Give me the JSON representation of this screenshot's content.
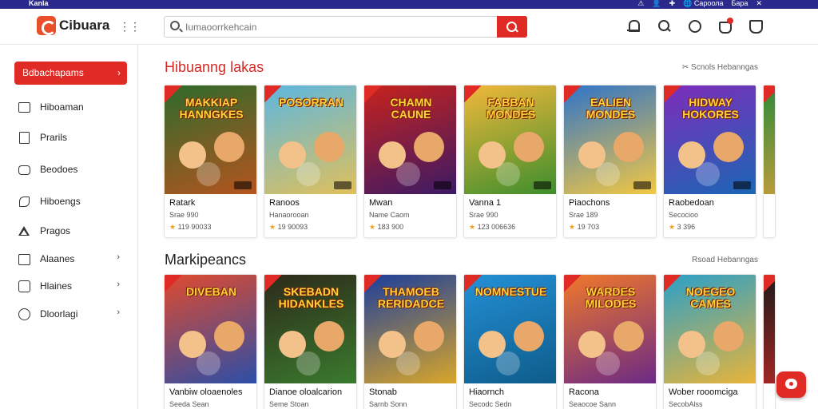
{
  "sysbar": {
    "brand": "Kanla",
    "items": [
      "⚠",
      "👤",
      "✚",
      "🌐 Сароола",
      "Бара",
      "✕"
    ]
  },
  "header": {
    "logo_text": "Cibuara",
    "search": {
      "placeholder": "Iumaoorrkehcain",
      "value": ""
    }
  },
  "sidebar": {
    "active": "Bdbachapams",
    "items": [
      {
        "label": "Hiboaman",
        "icon": "image-icon",
        "chevron": false
      },
      {
        "label": "Prarils",
        "icon": "document-icon",
        "chevron": false
      },
      {
        "label": "Beodoes",
        "icon": "pill-icon",
        "chevron": false
      },
      {
        "label": "Hiboengs",
        "icon": "phone-icon",
        "chevron": false
      },
      {
        "label": "Pragos",
        "icon": "triangle-icon",
        "chevron": false
      },
      {
        "label": "Alaanes",
        "icon": "square-icon",
        "chevron": true
      },
      {
        "label": "Hlaines",
        "icon": "badge-icon",
        "chevron": true
      },
      {
        "label": "Dloorlagi",
        "icon": "circle-icon",
        "chevron": true
      }
    ]
  },
  "sections": [
    {
      "title": "Hibuanng lakas",
      "link": "✂ Scnols  Hebanngas",
      "cards": [
        {
          "art_title": "MAKKIAP\nHANNGKES",
          "title": "Ratark",
          "sub": "Srae 990",
          "rating": "119 90033",
          "c1": "#2e6b2b",
          "c2": "#b5541f"
        },
        {
          "art_title": "POSORRAN",
          "title": "Ranoos",
          "sub": "Hanaorooan",
          "rating": "19 90093",
          "c1": "#5cb7e0",
          "c2": "#e1c05b"
        },
        {
          "art_title": "CHAMN\nCAUNE",
          "title": "Mwan",
          "sub": "Name Caom",
          "rating": "183 900",
          "c1": "#c8221c",
          "c2": "#3a1a66"
        },
        {
          "art_title": "FABBAN\nMONDES",
          "title": "Vanna 1",
          "sub": "Srae 990",
          "rating": "123 006636",
          "c1": "#f2b83a",
          "c2": "#3c8e2d"
        },
        {
          "art_title": "EALIEN\nMONDES",
          "title": "Piaochons",
          "sub": "Srae 189",
          "rating": "19 703",
          "c1": "#2f74c9",
          "c2": "#f4c842"
        },
        {
          "art_title": "HIDWAY\nHOKORES",
          "title": "Raobedoan",
          "sub": "Secocioo",
          "rating": "3 396",
          "c1": "#7e2dba",
          "c2": "#1b66b5"
        },
        {
          "art_title": "",
          "title": "",
          "sub": "",
          "rating": "",
          "c1": "#2b8a3a",
          "c2": "#e0a13a"
        }
      ]
    },
    {
      "title": "Markipeancs",
      "link": "Rsoad  Hebanngas",
      "cards": [
        {
          "art_title": "DIVEBAN",
          "title": "Vanbiw oloaenoles",
          "sub": "Seeda Sean",
          "rating": "",
          "c1": "#e04a2e",
          "c2": "#2b4ea8"
        },
        {
          "art_title": "SKEBADN\nHIDANKLES",
          "title": "Dianoe oloalcarion",
          "sub": "Seme Stoan",
          "rating": "",
          "c1": "#2d2a1a",
          "c2": "#3a7b2e"
        },
        {
          "art_title": "THAMOEB\nRERIDADCE",
          "title": "Stonab",
          "sub": "Sarnb Sonn",
          "rating": "",
          "c1": "#1b3e9c",
          "c2": "#d9a62a"
        },
        {
          "art_title": "NOMNESTUE",
          "title": "Hiaornch",
          "sub": "Secodc Sedn",
          "rating": "",
          "c1": "#2490d6",
          "c2": "#0d5c8a"
        },
        {
          "art_title": "WARDES\nMILODES",
          "title": "Racona",
          "sub": "Seaocoe Sann",
          "rating": "",
          "c1": "#f0782a",
          "c2": "#6b2a85"
        },
        {
          "art_title": "NOEGEO\nCAMES",
          "title": "Wober rooomciga",
          "sub": "SecobAlss",
          "rating": "",
          "c1": "#2aa0c8",
          "c2": "#e9b43a"
        },
        {
          "art_title": "",
          "title": "",
          "sub": "",
          "rating": "",
          "c1": "#1a1a1a",
          "c2": "#c82a26"
        }
      ]
    }
  ],
  "colors": {
    "accent": "#e02a25",
    "topbar": "#2b2a8c",
    "star": "#f1a01f"
  }
}
